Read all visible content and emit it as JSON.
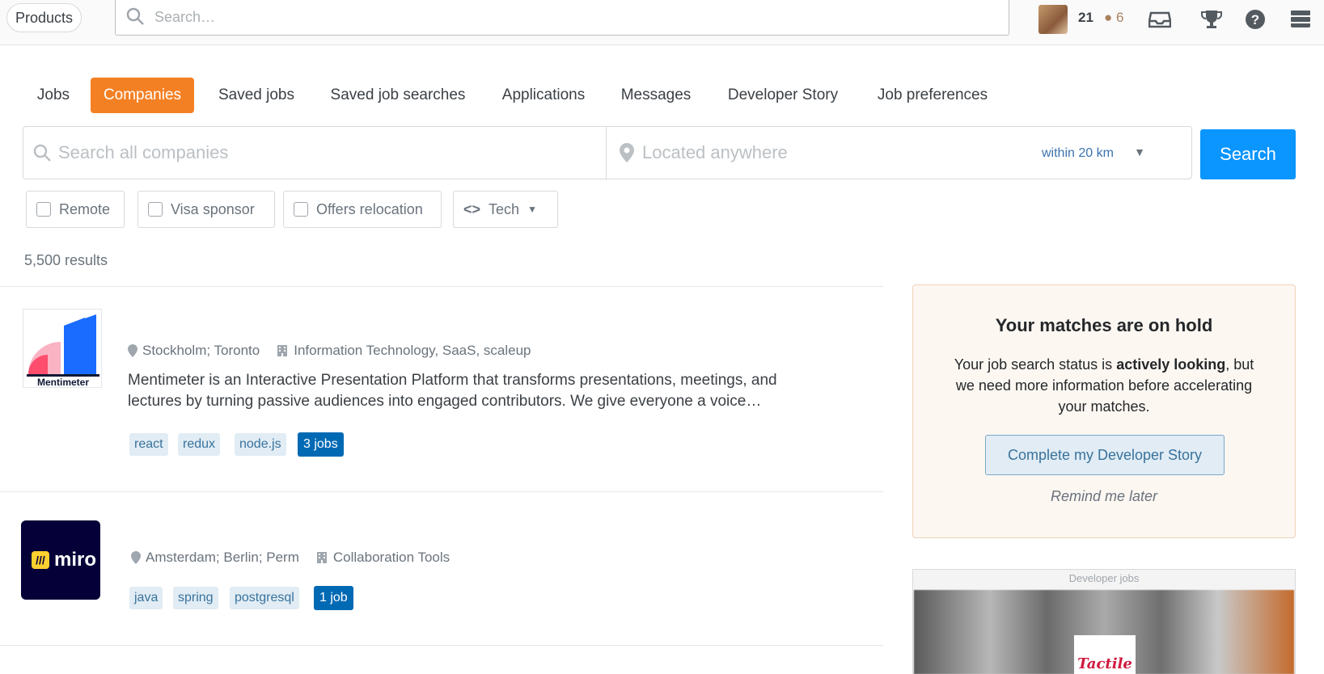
{
  "topbar": {
    "products_label": "Products",
    "search_placeholder": "Search…",
    "reputation": "21",
    "bronze_badges": "● 6"
  },
  "nav": {
    "tabs": [
      {
        "label": "Jobs",
        "active": false
      },
      {
        "label": "Companies",
        "active": true
      },
      {
        "label": "Saved jobs",
        "active": false
      },
      {
        "label": "Saved job searches",
        "active": false
      },
      {
        "label": "Applications",
        "active": false
      },
      {
        "label": "Messages",
        "active": false
      },
      {
        "label": "Developer Story",
        "active": false
      },
      {
        "label": "Job preferences",
        "active": false
      }
    ]
  },
  "search": {
    "company_placeholder": "Search all companies",
    "location_placeholder": "Located anywhere",
    "distance": "within 20 km",
    "button": "Search"
  },
  "filters": {
    "remote": "Remote",
    "visa": "Visa sponsor",
    "relocation": "Offers relocation",
    "tech": "Tech"
  },
  "results_count": "5,500 results",
  "companies": [
    {
      "logo_text": "Mentimeter",
      "location": "Stockholm; Toronto",
      "industry": "Information Technology, SaaS, scaleup",
      "description": "Mentimeter is an Interactive Presentation Platform that transforms presentations, meetings, and lectures by turning passive audiences into engaged contributors. We give everyone a voice…",
      "tags": [
        "react",
        "redux",
        "node.js"
      ],
      "jobs": "3 jobs"
    },
    {
      "logo_text": "miro",
      "location": "Amsterdam; Berlin; Perm",
      "industry": "Collaboration Tools",
      "tags": [
        "java",
        "spring",
        "postgresql"
      ],
      "jobs": "1 job"
    }
  ],
  "hold_panel": {
    "title": "Your matches are on hold",
    "text_before": "Your job search status is ",
    "text_bold": "actively looking",
    "text_after": ", but we need more information before accelerating your matches.",
    "button": "Complete my Developer Story",
    "remind": "Remind me later"
  },
  "ad": {
    "label": "Developer jobs",
    "logo": "Tactile"
  },
  "colors": {
    "brand_orange": "#f48024",
    "search_blue": "#0a95ff",
    "link_blue": "#0077cc"
  }
}
